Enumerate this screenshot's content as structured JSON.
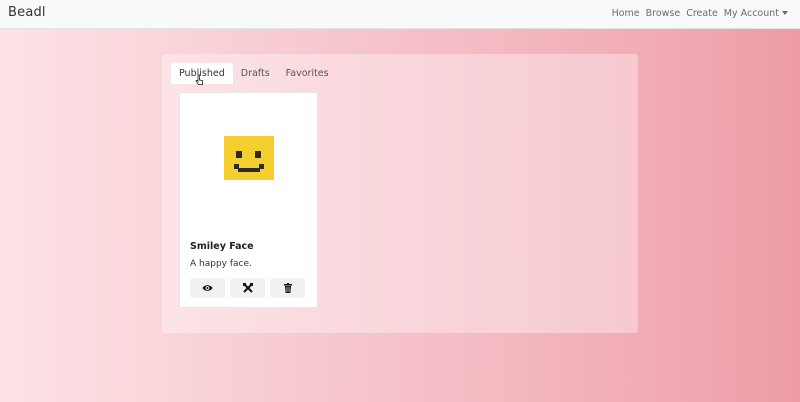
{
  "navbar": {
    "brand": "Beadl",
    "links": [
      "Home",
      "Browse",
      "Create",
      "My Account"
    ]
  },
  "tabs": [
    "Published",
    "Drafts",
    "Favorites"
  ],
  "active_tab": "Published",
  "card": {
    "title": "Smiley Face",
    "description": "A happy face.",
    "thumbnail_icon": "smiley-bead-pattern",
    "thumbnail_color": "#f5cf2f",
    "actions": [
      "view-icon",
      "edit-tools-icon",
      "trash-icon"
    ]
  },
  "colors": {
    "background_left": "#fde3e6",
    "background_right": "#ee9ca7",
    "navbar": "#f8f9fa"
  }
}
